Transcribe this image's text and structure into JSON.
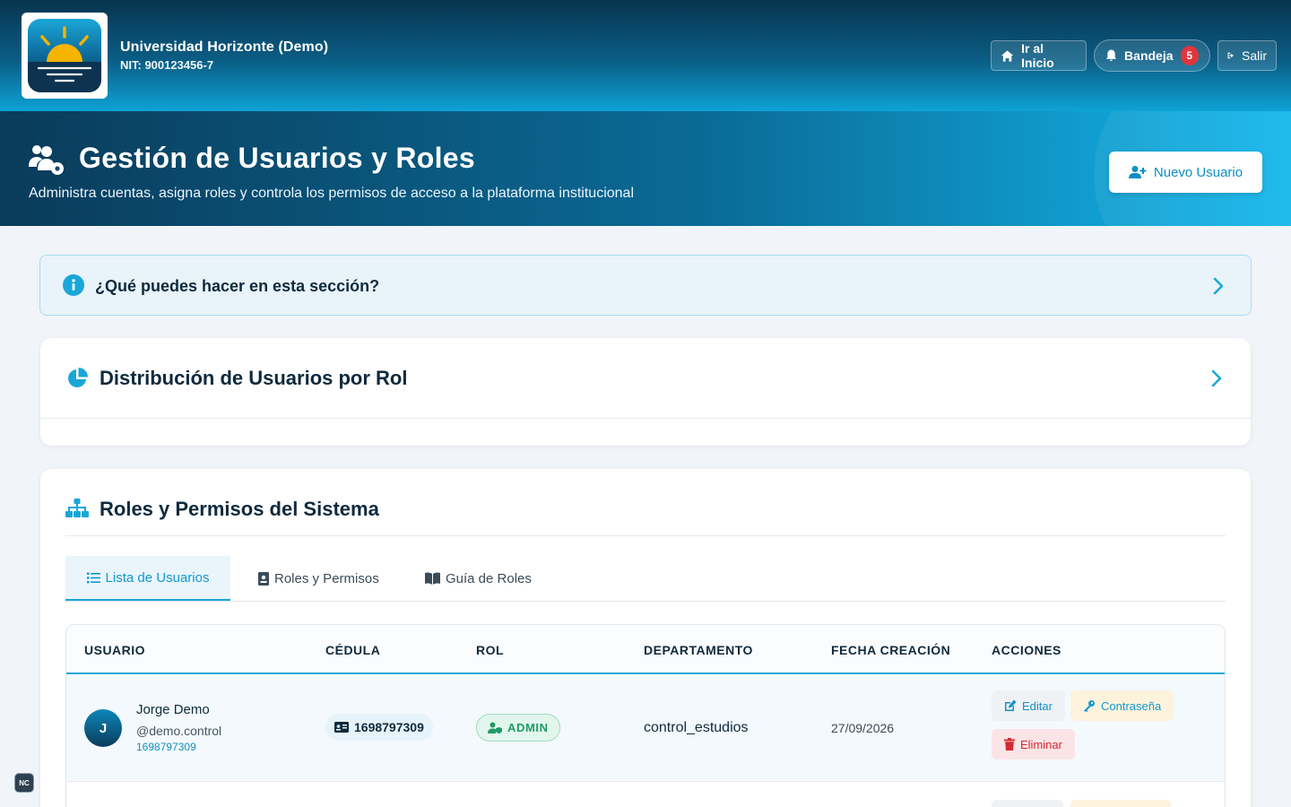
{
  "topbar": {
    "org_name": "Universidad Horizonte (Demo)",
    "org_nit": "NIT: 900123456-7",
    "home_label": "Ir al Inicio",
    "inbox_label": "Bandeja",
    "inbox_count": "5",
    "logout_label": "Salir"
  },
  "header": {
    "title": "Gestión de Usuarios y Roles",
    "subtitle": "Administra cuentas, asigna roles y controla los permisos de acceso a la plataforma institucional",
    "new_user_label": "Nuevo Usuario"
  },
  "info": {
    "label": "¿Qué puedes hacer en esta sección?"
  },
  "distribution": {
    "title": "Distribución de Usuarios por Rol"
  },
  "roles_section": {
    "title": "Roles y Permisos del Sistema",
    "tabs": [
      {
        "label": "Lista de Usuarios",
        "active": true
      },
      {
        "label": "Roles y Permisos",
        "active": false
      },
      {
        "label": "Guía de Roles",
        "active": false
      }
    ]
  },
  "table": {
    "columns": [
      "USUARIO",
      "CÉDULA",
      "ROL",
      "DEPARTAMENTO",
      "FECHA CREACIÓN",
      "ACCIONES"
    ],
    "rows": [
      {
        "initial": "J",
        "name": "Jorge Demo",
        "handle": "@demo.control",
        "cedula_small": "1698797309",
        "cedula": "1698797309",
        "role": "ADMIN",
        "department": "control_estudios",
        "created": "27/09/2026",
        "actions": {
          "edit": "Editar",
          "password": "Contraseña",
          "delete": "Eliminar"
        }
      }
    ]
  },
  "footer_badge": "NC",
  "colors": {
    "accent": "#1aa7d8",
    "dark": "#0f2a3d",
    "danger": "#d42b33",
    "success": "#1f9a66"
  }
}
